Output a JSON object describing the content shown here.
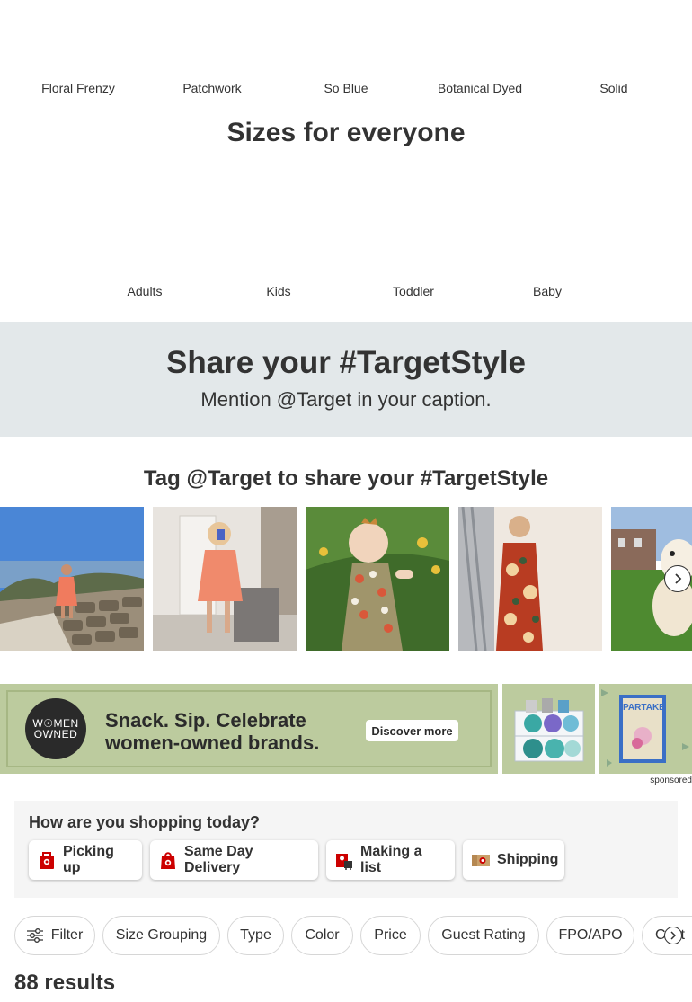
{
  "patterns": [
    {
      "label": "Floral Frenzy"
    },
    {
      "label": "Patchwork"
    },
    {
      "label": "So Blue"
    },
    {
      "label": "Botanical Dyed"
    },
    {
      "label": "Solid"
    }
  ],
  "sizes": {
    "title": "Sizes for everyone",
    "items": [
      {
        "label": "Adults"
      },
      {
        "label": "Kids"
      },
      {
        "label": "Toddler"
      },
      {
        "label": "Baby"
      }
    ]
  },
  "share": {
    "title": "Share your #TargetStyle",
    "subtitle": "Mention @Target in your caption."
  },
  "gallery": {
    "title": "Tag @Target to share your #TargetStyle"
  },
  "ad": {
    "logo_line1": "W☉MEN",
    "logo_line2": "OWNED",
    "headline_line1": "Snack. Sip. Celebrate",
    "headline_line2": "women-owned brands.",
    "cta": "Discover more",
    "product_brand": "PARTAKE",
    "sponsored": "sponsored"
  },
  "shopping": {
    "title": "How are you shopping today?",
    "options": [
      {
        "label": "Picking up"
      },
      {
        "label": "Same Day Delivery"
      },
      {
        "label": "Making a list"
      },
      {
        "label": "Shipping"
      }
    ]
  },
  "filters": [
    {
      "label": "Filter"
    },
    {
      "label": "Size Grouping"
    },
    {
      "label": "Type"
    },
    {
      "label": "Color"
    },
    {
      "label": "Price"
    },
    {
      "label": "Guest Rating"
    },
    {
      "label": "FPO/APO"
    },
    {
      "label": "Cost"
    }
  ],
  "results": "88 results",
  "colors": {
    "target_red": "#cc0000",
    "share_band": "#e3e8ea",
    "ad_green": "#bccb9e"
  }
}
